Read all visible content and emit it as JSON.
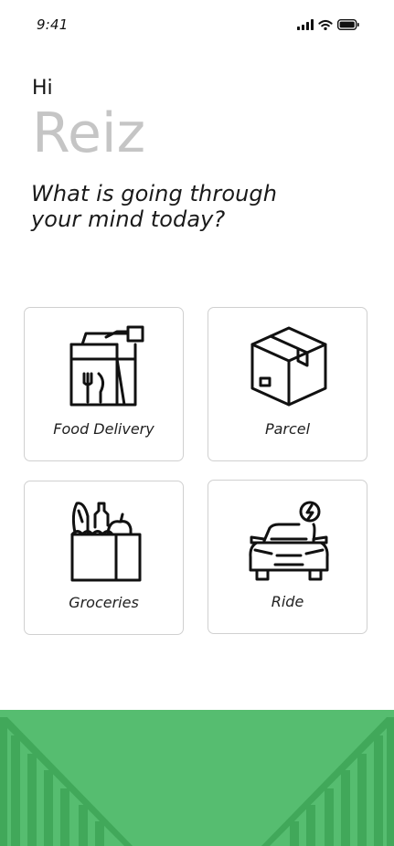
{
  "status_bar": {
    "time": "9:41",
    "icons": [
      "signal-icon",
      "wifi-icon",
      "battery-icon"
    ]
  },
  "header": {
    "greeting": "Hi",
    "name": "Reiz",
    "prompt": "What is going through your mind today?"
  },
  "services": [
    {
      "label": "Food Delivery",
      "icon": "food-delivery-bag-icon"
    },
    {
      "label": "Parcel",
      "icon": "parcel-box-icon"
    },
    {
      "label": "Groceries",
      "icon": "groceries-bag-icon"
    },
    {
      "label": "Ride",
      "icon": "car-icon"
    }
  ],
  "colors": {
    "accent": "#56bd70",
    "accent_dark": "#41a85a",
    "name_gray": "#c5c5c5",
    "card_border": "#d0d0d0"
  }
}
